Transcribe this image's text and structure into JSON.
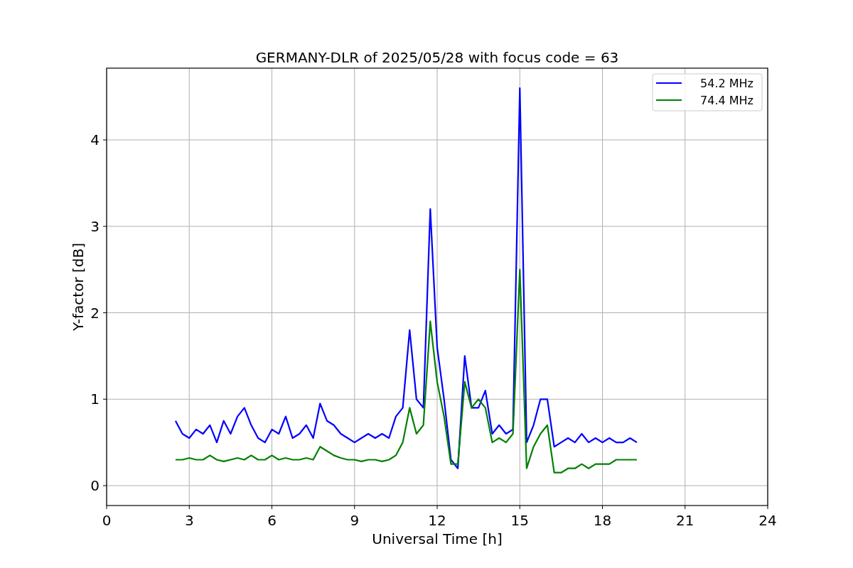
{
  "figure": {
    "chart_data": {
      "type": "line",
      "title": "GERMANY-DLR of 2025/05/28 with focus code = 63",
      "xlabel": "Universal Time [h]",
      "ylabel": "Y-factor [dB]",
      "xlim": [
        0,
        24
      ],
      "ylim": [
        -0.23,
        4.83
      ],
      "xticks": [
        0,
        3,
        6,
        9,
        12,
        15,
        18,
        21,
        24
      ],
      "yticks": [
        0,
        1,
        2,
        3,
        4
      ],
      "grid": true,
      "legend": true,
      "x": [
        2.5,
        2.75,
        3,
        3.25,
        3.5,
        3.75,
        4,
        4.25,
        4.5,
        4.75,
        5,
        5.25,
        5.5,
        5.75,
        6,
        6.25,
        6.5,
        6.75,
        7,
        7.25,
        7.5,
        7.75,
        8,
        8.25,
        8.5,
        8.75,
        9,
        9.25,
        9.5,
        9.75,
        10,
        10.25,
        10.5,
        10.75,
        11,
        11.25,
        11.5,
        11.75,
        12,
        12.25,
        12.5,
        12.75,
        13,
        13.25,
        13.5,
        13.75,
        14,
        14.25,
        14.5,
        14.75,
        15,
        15.25,
        15.5,
        15.75,
        16,
        16.25,
        16.5,
        16.75,
        17,
        17.25,
        17.5,
        17.75,
        18,
        18.25,
        18.5,
        18.75,
        19,
        19.25
      ],
      "series": [
        {
          "name": "54.2 MHz",
          "color": "#0000ff",
          "values": [
            0.75,
            0.6,
            0.55,
            0.65,
            0.6,
            0.7,
            0.5,
            0.75,
            0.6,
            0.8,
            0.9,
            0.7,
            0.55,
            0.5,
            0.65,
            0.6,
            0.8,
            0.55,
            0.6,
            0.7,
            0.55,
            0.95,
            0.75,
            0.7,
            0.6,
            0.55,
            0.5,
            0.55,
            0.6,
            0.55,
            0.6,
            0.55,
            0.8,
            0.9,
            1.8,
            1.0,
            0.9,
            3.2,
            1.6,
            1.0,
            0.3,
            0.2,
            1.5,
            0.9,
            0.9,
            1.1,
            0.6,
            0.7,
            0.6,
            0.65,
            4.6,
            0.5,
            0.7,
            1.0,
            1.0,
            0.45,
            0.5,
            0.55,
            0.5,
            0.6,
            0.5,
            0.55,
            0.5,
            0.55,
            0.5,
            0.5,
            0.55,
            0.5
          ]
        },
        {
          "name": "74.4 MHz",
          "color": "#008000",
          "values": [
            0.3,
            0.3,
            0.32,
            0.3,
            0.3,
            0.35,
            0.3,
            0.28,
            0.3,
            0.32,
            0.3,
            0.35,
            0.3,
            0.3,
            0.35,
            0.3,
            0.32,
            0.3,
            0.3,
            0.32,
            0.3,
            0.45,
            0.4,
            0.35,
            0.32,
            0.3,
            0.3,
            0.28,
            0.3,
            0.3,
            0.28,
            0.3,
            0.35,
            0.5,
            0.9,
            0.6,
            0.7,
            1.9,
            1.2,
            0.8,
            0.25,
            0.25,
            1.2,
            0.9,
            1.0,
            0.9,
            0.5,
            0.55,
            0.5,
            0.6,
            2.5,
            0.2,
            0.45,
            0.6,
            0.7,
            0.15,
            0.15,
            0.2,
            0.2,
            0.25,
            0.2,
            0.25,
            0.25,
            0.25,
            0.3,
            0.3,
            0.3,
            0.3
          ]
        }
      ]
    }
  }
}
